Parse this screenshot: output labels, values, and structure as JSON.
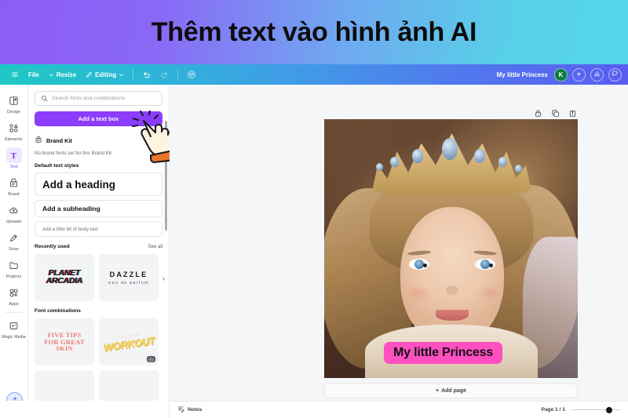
{
  "banner": {
    "title": "Thêm text vào hình ảnh AI",
    "gradient_from": "#8d5cf7",
    "gradient_to": "#55d7e9"
  },
  "toolbar": {
    "menu_icon": "hamburger-icon",
    "file_label": "File",
    "resize_label": "Resize",
    "editing_label": "Editing",
    "undo_icon": "undo-icon",
    "redo_icon": "redo-icon",
    "sync_icon": "cloud-check-icon",
    "doc_title": "My little Princess",
    "avatar_initial": "K",
    "add_member_label": "+",
    "analytics_icon": "bar-chart-icon",
    "comment_icon": "comment-bubble-icon",
    "gradient_from": "#1fc8c4",
    "gradient_to": "#5a5df0"
  },
  "rail": {
    "items": [
      {
        "label": "Design",
        "icon": "design-icon",
        "active": false
      },
      {
        "label": "Elements",
        "icon": "elements-icon",
        "active": false
      },
      {
        "label": "Text",
        "icon": "text-icon",
        "active": true
      },
      {
        "label": "Brand",
        "icon": "brand-icon",
        "active": false
      },
      {
        "label": "Uploads",
        "icon": "uploads-icon",
        "active": false
      },
      {
        "label": "Draw",
        "icon": "draw-icon",
        "active": false
      },
      {
        "label": "Projects",
        "icon": "projects-icon",
        "active": false
      },
      {
        "label": "Apps",
        "icon": "apps-icon",
        "active": false
      },
      {
        "label": "Magic Media",
        "icon": "magic-media-icon",
        "active": false
      }
    ],
    "ai_button_icon": "magic-star-icon",
    "active_color": "#7c3aed"
  },
  "panel": {
    "search_placeholder": "Search fonts and combinations",
    "search_icon": "search-icon",
    "add_text_box_label": "Add a text box",
    "add_text_box_color": "#8b3dfb",
    "brand_kit_title": "Brand Kit",
    "brand_kit_icon": "brand-kit-icon",
    "brand_kit_note": "No brand fonts set for this Brand Kit",
    "default_styles_title": "Default text styles",
    "styles": [
      {
        "label": "Add a heading"
      },
      {
        "label": "Add a subheading"
      },
      {
        "label": "Add a little bit of body text"
      }
    ],
    "recently_used_title": "Recently used",
    "see_all_label": "See all",
    "recent_cards": [
      {
        "line1": "PLANET",
        "line2": "ARCADIA"
      },
      {
        "line1": "DAZZLE",
        "line2": "eau de parfum"
      }
    ],
    "font_combinations_title": "Font combinations",
    "combination_cards": [
      {
        "line1": "FIVE TIPS",
        "line2": "FOR GREAT",
        "line3": "SKIN"
      },
      {
        "pre": "TIME FOR",
        "main": "WORKOUT"
      }
    ],
    "chevron_icon": "chevron-right-icon",
    "scroll_down_icon": "chevron-down-icon"
  },
  "canvas": {
    "tools": [
      {
        "icon": "lock-icon",
        "name": "lock-button"
      },
      {
        "icon": "duplicate-icon",
        "name": "duplicate-button"
      },
      {
        "icon": "export-icon",
        "name": "export-button"
      }
    ],
    "overlay_text": "My little Princess",
    "overlay_bg": "#ff4fc0",
    "overlay_text_color": "#111216",
    "add_page_label": "Add page",
    "add_page_plus": "+"
  },
  "bottombar": {
    "notes_label": "Notes",
    "notes_icon": "notes-icon",
    "page_count": "Page 1 / 1",
    "zoom_value": 70
  },
  "cursor": {
    "icon": "pointing-hand-cursor"
  }
}
